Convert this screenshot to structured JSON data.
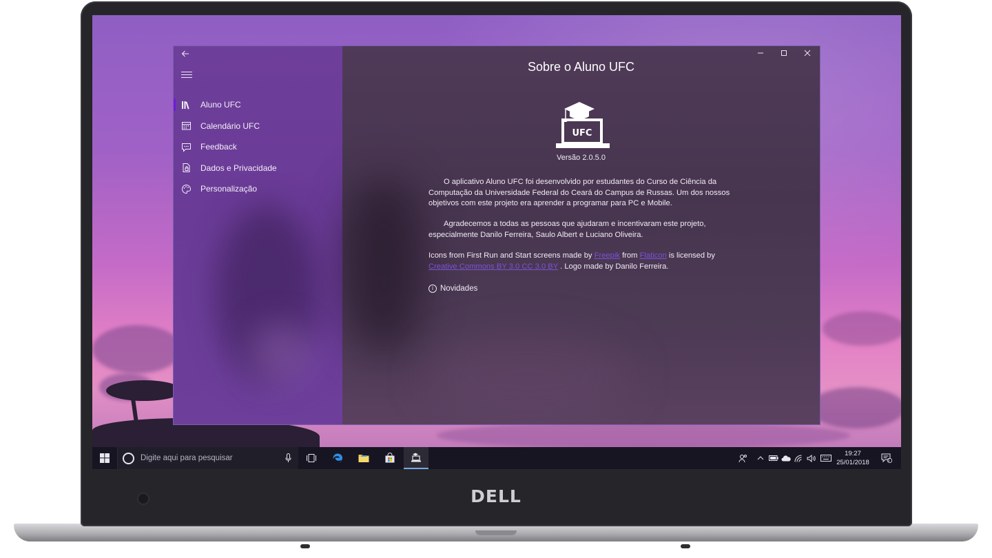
{
  "device": {
    "brand_logo": "DELL"
  },
  "app": {
    "title": "Sobre o Aluno UFC",
    "nav": [
      {
        "label": "Aluno UFC",
        "icon": "library-icon",
        "selected": true
      },
      {
        "label": "Calendário UFC",
        "icon": "calendar-icon",
        "selected": false
      },
      {
        "label": "Feedback",
        "icon": "feedback-icon",
        "selected": false
      },
      {
        "label": "Dados e Privacidade",
        "icon": "privacy-icon",
        "selected": false
      },
      {
        "label": "Personalização",
        "icon": "palette-icon",
        "selected": false
      }
    ],
    "logo_text": "UFC",
    "version": "Versão 2.0.5.0",
    "paragraph1": "O aplicativo Aluno UFC foi desenvolvido por estudantes do Curso de Ciência da Computação da Universidade Federal do Ceará do Campus de Russas. Um dos nossos objetivos com este projeto era aprender a programar para PC e Mobile.",
    "paragraph2": "Agradecemos a todas as pessoas que ajudaram e incentivaram este projeto, especialmente Danilo Ferreira, Saulo Albert e Luciano Oliveira.",
    "credits": {
      "prefix": "Icons from First Run and Start screens made by",
      "link1": "Freepik",
      "mid1": "from",
      "link2": "Flaticon",
      "mid2": "is licensed by",
      "link3": "Creative Commons BY 3.0 CC 3.0 BY",
      "suffix": ". Logo made by Danilo Ferreira."
    },
    "novidades": "Novidades"
  },
  "taskbar": {
    "search_placeholder": "Digite aqui para pesquisar",
    "time": "19:27",
    "date": "25/01/2018",
    "notification_count": "1"
  },
  "colors": {
    "nav_bg": "#6a3b97",
    "content_bg": "#4b3853",
    "selection_accent": "#6f1cd6",
    "link": "#7c52d6",
    "taskbar": "#171521"
  }
}
